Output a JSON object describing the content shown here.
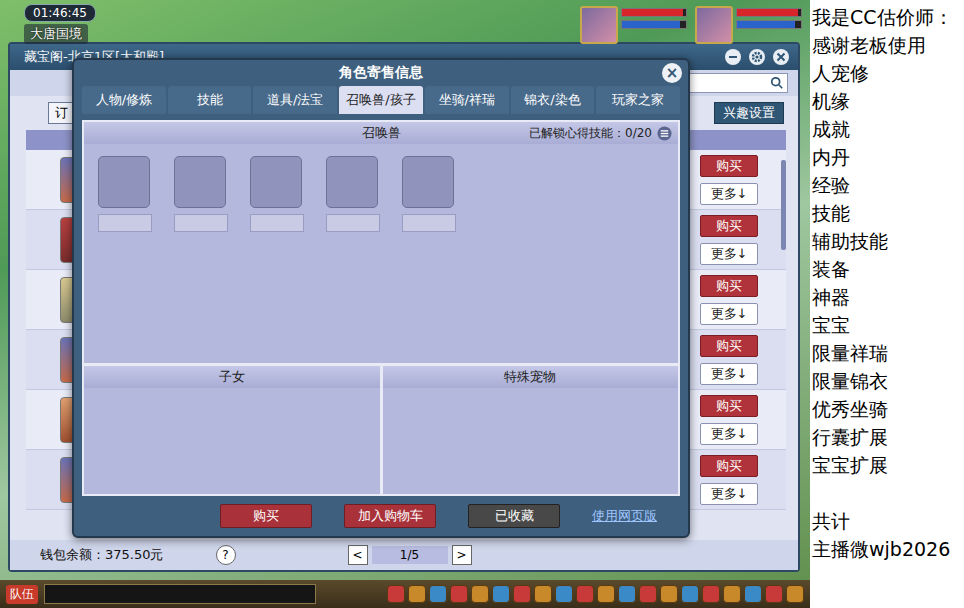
{
  "hud": {
    "time": "01:46:45",
    "location": "大唐国境"
  },
  "party": [
    {
      "hp": 0.95,
      "mp": 0.9
    },
    {
      "hp": 0.95,
      "mp": 0.9
    }
  ],
  "market": {
    "title": "藏宝阁-北京1区[大和殿]",
    "filter_label": "订",
    "interest_button": "兴趣设置",
    "rows": [
      {
        "buy": "购买",
        "more": "更多↓"
      },
      {
        "buy": "购买",
        "more": "更多↓"
      },
      {
        "buy": "购买",
        "more": "更多↓"
      },
      {
        "buy": "购买",
        "more": "更多↓"
      },
      {
        "buy": "购买",
        "more": "更多↓"
      },
      {
        "buy": "购买",
        "more": "更多↓"
      }
    ],
    "wallet": "钱包余额：375.50元",
    "help": "?",
    "pager": {
      "prev": "<",
      "page": "1/5",
      "next": ">"
    }
  },
  "dialog": {
    "title": "角色寄售信息",
    "close": "×",
    "tabs": [
      {
        "label": "人物/修炼",
        "selected": false
      },
      {
        "label": "技能",
        "selected": false
      },
      {
        "label": "道具/法宝",
        "selected": false
      },
      {
        "label": "召唤兽/孩子",
        "selected": true
      },
      {
        "label": "坐骑/祥瑞",
        "selected": false
      },
      {
        "label": "锦衣/染色",
        "selected": false
      },
      {
        "label": "玩家之家",
        "selected": false
      }
    ],
    "pets_panel": {
      "title": "召唤兽",
      "unlocked": "已解锁心得技能：0/20",
      "slots": [
        {
          "empty": true
        },
        {
          "empty": true
        },
        {
          "empty": true
        },
        {
          "empty": true
        },
        {
          "empty": true
        }
      ]
    },
    "children_panel": "子女",
    "special_panel": "特殊宠物",
    "buttons": [
      {
        "label": "购买",
        "kind": "red"
      },
      {
        "label": "加入购物车",
        "kind": "red"
      },
      {
        "label": "已收藏",
        "kind": "dark"
      },
      {
        "label": "使用网页版",
        "kind": "link"
      }
    ]
  },
  "bottom_bar": {
    "team": "队伍"
  },
  "overlay": {
    "intro": "我是CC估价师：",
    "thanks": "感谢老板使用",
    "items": [
      "人宠修",
      "机缘",
      "成就",
      "内丹",
      "经验",
      "技能",
      "辅助技能",
      "装备",
      "神器",
      "宝宝",
      "限量祥瑞",
      "限量锦衣",
      "优秀坐骑",
      "行囊扩展",
      "宝宝扩展"
    ],
    "total": "共计",
    "contact": "主播微wjb2026"
  }
}
